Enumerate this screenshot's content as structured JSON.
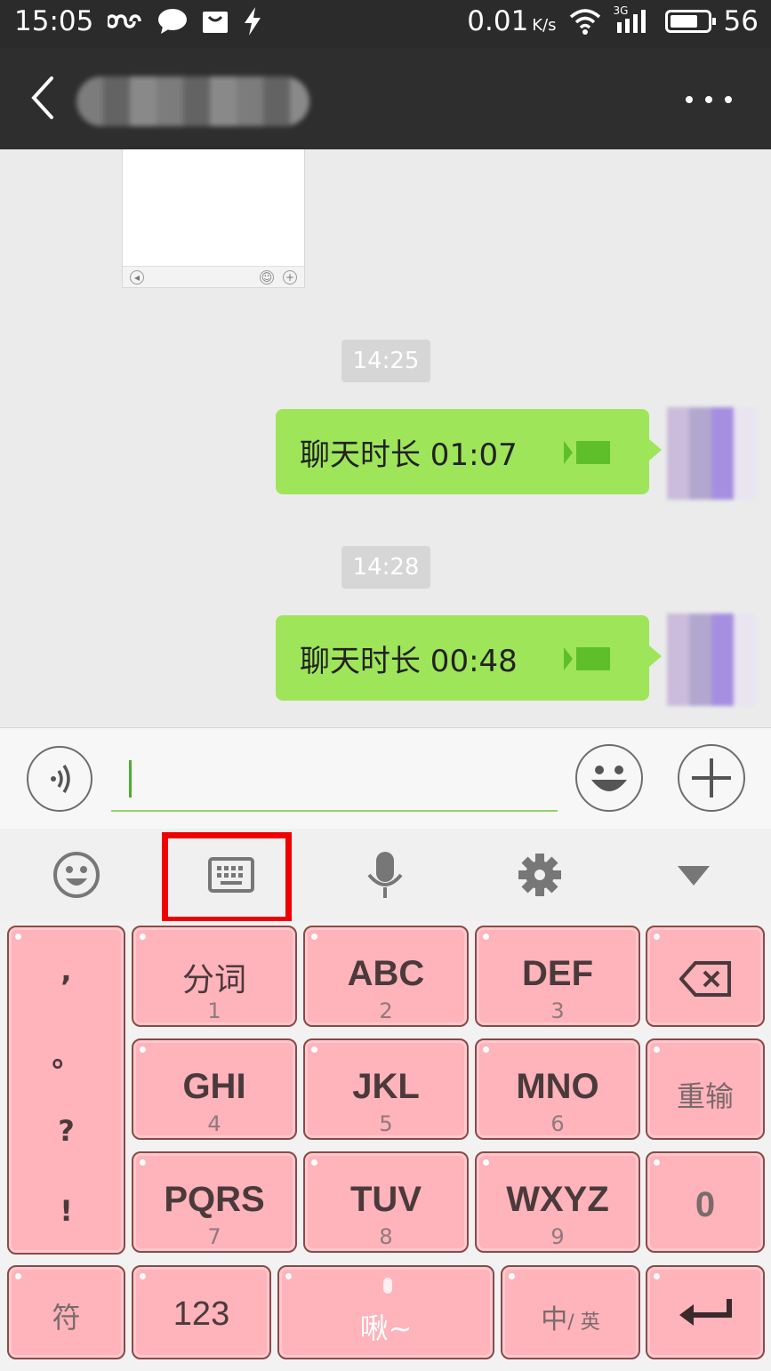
{
  "status_bar": {
    "time": "15:05",
    "speed": "0.01",
    "speed_unit": "K/s",
    "network": "3G",
    "battery": "56"
  },
  "chat": {
    "messages": [
      {
        "time": "14:25",
        "text": "聊天时长 01:07",
        "type": "video-call-record"
      },
      {
        "time": "14:28",
        "text": "聊天时长 00:48",
        "type": "video-call-record"
      }
    ]
  },
  "input": {
    "value": ""
  },
  "keyboard": {
    "punctuation": [
      ",",
      "。",
      "?",
      "!"
    ],
    "keys": {
      "k1": {
        "main": "分词",
        "sub": "1"
      },
      "k2": {
        "main": "ABC",
        "sub": "2"
      },
      "k3": {
        "main": "DEF",
        "sub": "3"
      },
      "k4": {
        "main": "GHI",
        "sub": "4"
      },
      "k5": {
        "main": "JKL",
        "sub": "5"
      },
      "k6": {
        "main": "MNO",
        "sub": "6"
      },
      "k7": {
        "main": "PQRS",
        "sub": "7"
      },
      "k8": {
        "main": "TUV",
        "sub": "8"
      },
      "k9": {
        "main": "WXYZ",
        "sub": "9"
      },
      "k0": {
        "main": "0"
      },
      "reinput": "重输",
      "symbols": "符",
      "num": "123",
      "space": "啾~",
      "lang_main": "中",
      "lang_alt": "/ 英"
    }
  },
  "colors": {
    "bubble": "#9ee55a",
    "key": "#ffb3bb",
    "highlight": "#f00000",
    "header": "#2e2e2e"
  }
}
